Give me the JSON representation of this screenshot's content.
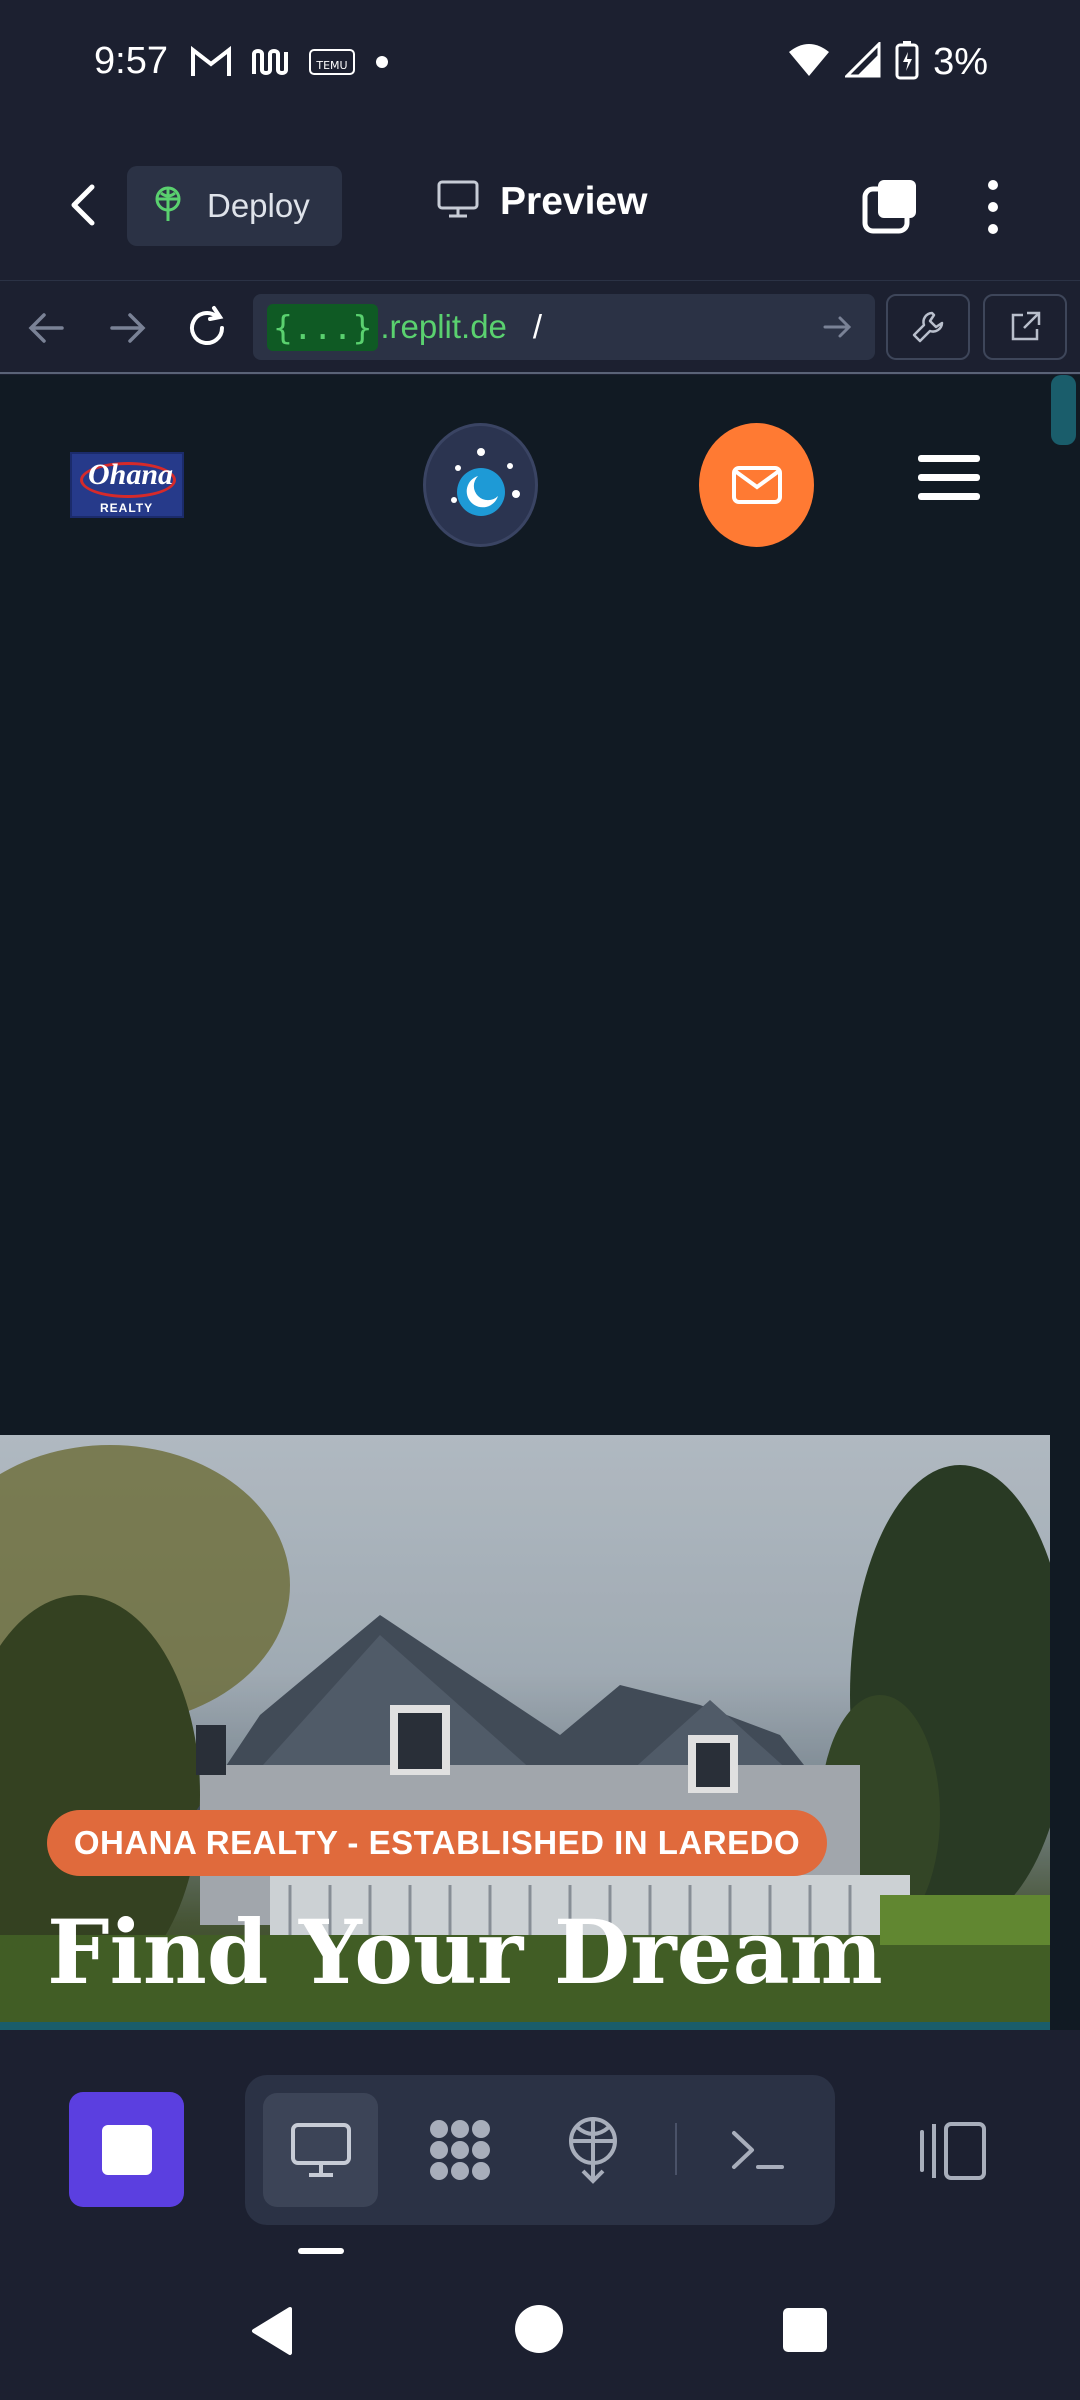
{
  "status_bar": {
    "time": "9:57",
    "notification_icons": [
      "gmail-icon",
      "app-icon",
      "temu-icon"
    ],
    "battery_percent": "3%"
  },
  "top_bar": {
    "deploy_label": "Deploy",
    "preview_label": "Preview"
  },
  "url_bar": {
    "badge": "{...}",
    "host": ".replit.de",
    "path": "/"
  },
  "site": {
    "logo_name": "Ohana",
    "logo_sub": "REALTY",
    "hero_badge": "OHANA REALTY - ESTABLISHED IN LAREDO",
    "hero_title": "Find Your Dream"
  },
  "colors": {
    "accent_orange": "#ff7a33",
    "stop_purple": "#5b3fe0",
    "url_green": "#5ad16f"
  }
}
